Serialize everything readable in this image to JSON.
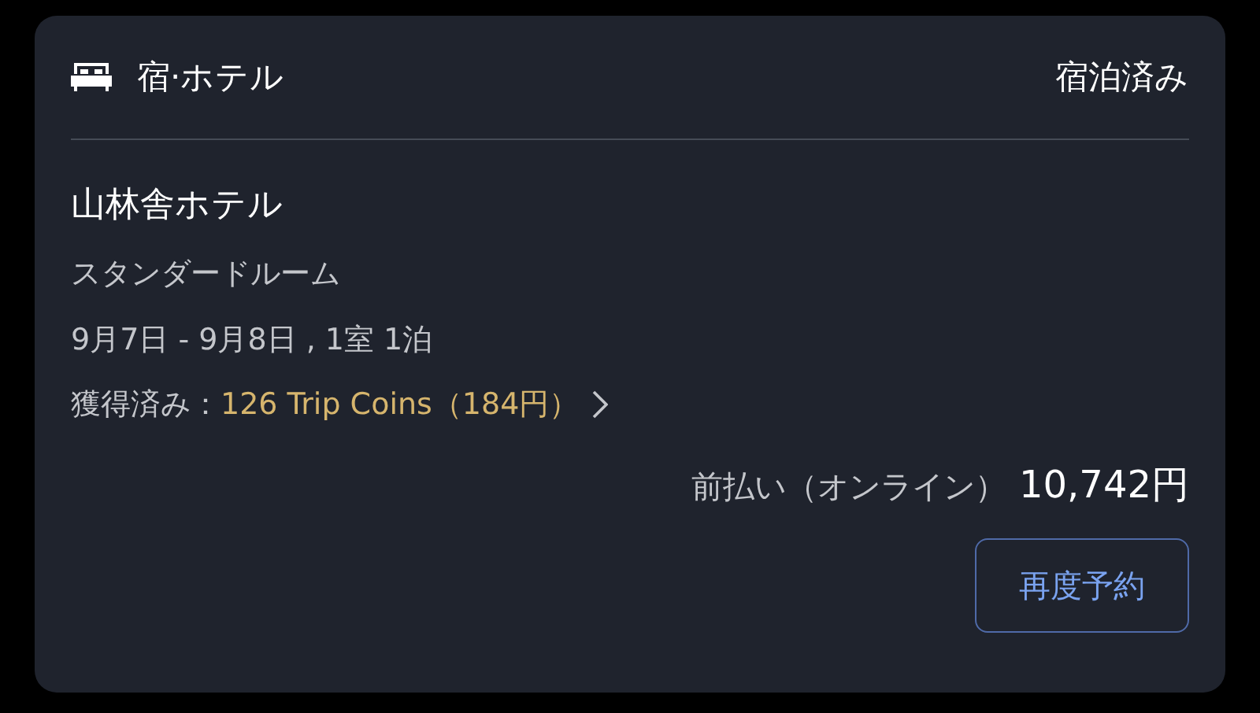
{
  "card": {
    "category": "宿·ホテル",
    "status": "宿泊済み",
    "hotel_name": "山林舎ホテル",
    "room_type": "スタンダードルーム",
    "stay": "9月7日 - 9月8日 , 1室 1泊",
    "earned_label": "獲得済み：",
    "earned_link": "126 Trip Coins（184円）",
    "payment_label": "前払い（オンライン）",
    "payment_amount": "10,742円",
    "rebook_button": "再度予約"
  }
}
